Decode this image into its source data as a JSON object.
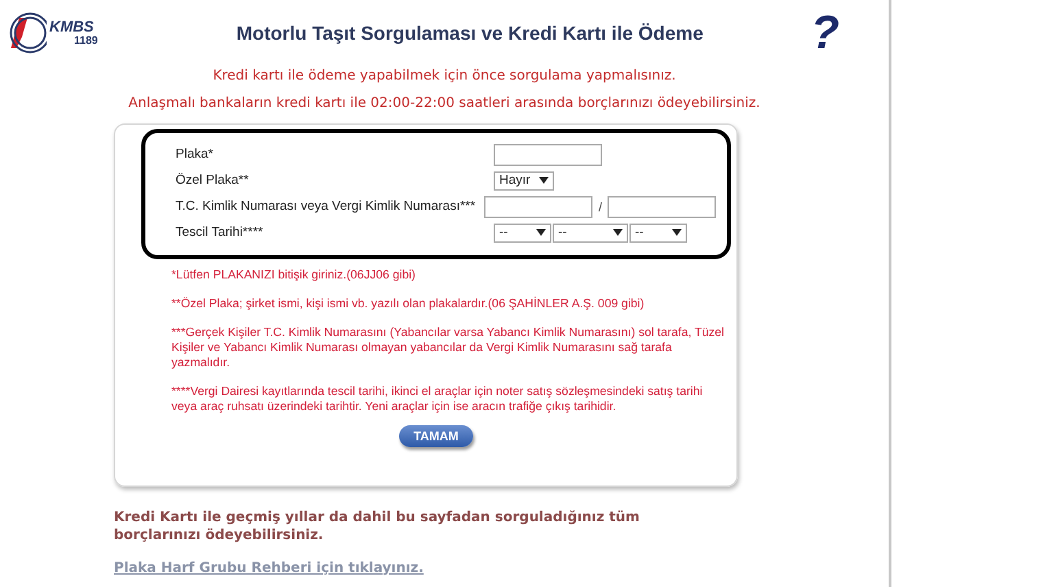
{
  "logo": {
    "brand": "KMBS",
    "number": "1189"
  },
  "title": "Motorlu Taşıt Sorgulaması ve Kredi Kartı ile Ödeme",
  "help_icon": "?",
  "notices": [
    "Kredi kartı ile ödeme yapabilmek için önce sorgulama yapmalısınız.",
    "Anlaşmalı bankaların kredi kartı ile 02:00-22:00 saatleri arasında borçlarınızı ödeyebilirsiniz."
  ],
  "form": {
    "fields": [
      {
        "label": "Plaka*",
        "kind": "text"
      },
      {
        "label": "Özel Plaka**",
        "kind": "select",
        "values": [
          "Hayır"
        ]
      },
      {
        "label": "T.C. Kimlik Numarası veya Vergi Kimlik Numarası***",
        "kind": "pair",
        "separator": "/"
      },
      {
        "label": "Tescil Tarihi****",
        "kind": "date",
        "values": [
          "--",
          "--",
          "--"
        ]
      }
    ],
    "notes": [
      "*Lütfen PLAKANIZI bitişik giriniz.(06JJ06 gibi)",
      "**Özel Plaka; şirket ismi, kişi ismi vb. yazılı olan plakalardır.(06 ŞAHİNLER A.Ş. 009 gibi)",
      "***Gerçek Kişiler T.C. Kimlik Numarasını (Yabancılar varsa Yabancı Kimlik Numarasını) sol tarafa, Tüzel Kişiler ve Yabancı Kimlik Numarası olmayan yabancılar da Vergi Kimlik Numarasını sağ tarafa yazmalıdır.",
      "****Vergi Dairesi kayıtlarında tescil tarihi, ikinci el araçlar için noter satış sözleşmesindeki satış tarihi veya araç ruhsatı üzerindeki tarihtir. Yeni araçlar için ise aracın trafiğe çıkış tarihidir."
    ],
    "submit": "TAMAM"
  },
  "footer_text": "Kredi Kartı ile geçmiş yıllar da dahil bu sayfadan sorguladığınız tüm borçlarınızı ödeyebilirsiniz.",
  "footer_link": "Plaka Harf Grubu Rehberi için tıklayınız."
}
